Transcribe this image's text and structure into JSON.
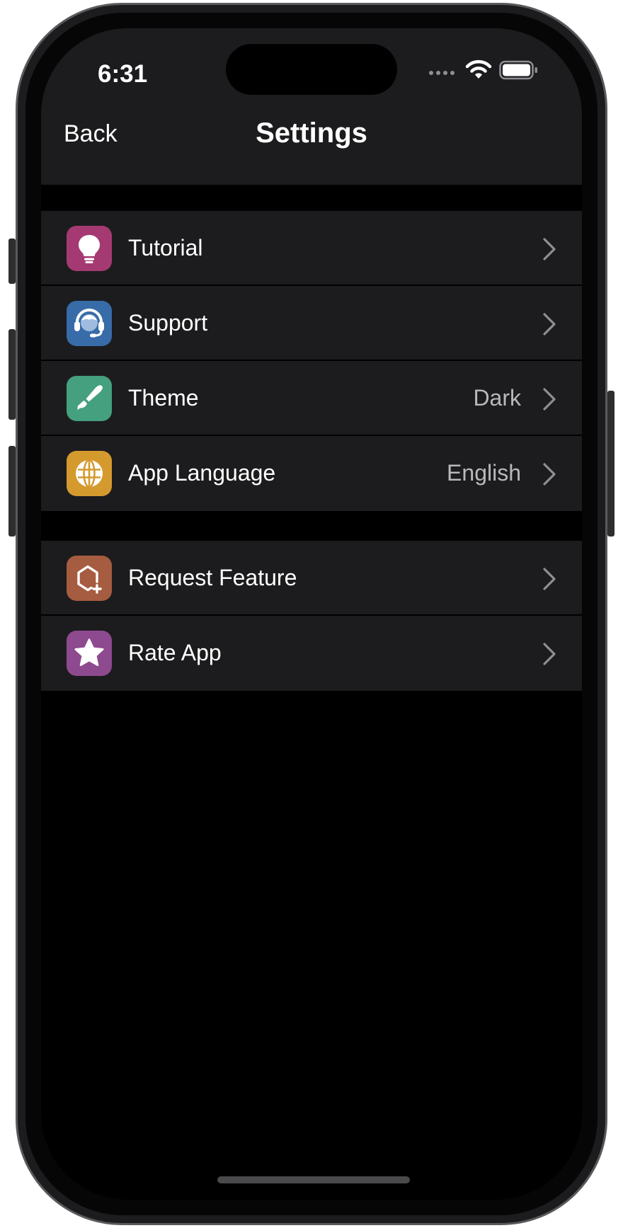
{
  "status_bar": {
    "time": "6:31"
  },
  "nav": {
    "back_label": "Back",
    "title": "Settings"
  },
  "groups": [
    {
      "items": [
        {
          "label": "Tutorial",
          "value": "",
          "icon": "lightbulb-icon",
          "icon_color": "#A53A72"
        },
        {
          "label": "Support",
          "value": "",
          "icon": "headset-icon",
          "icon_color": "#376CA8"
        },
        {
          "label": "Theme",
          "value": "Dark",
          "icon": "paintbrush-icon",
          "icon_color": "#45A07F"
        },
        {
          "label": "App Language",
          "value": "English",
          "icon": "globe-icon",
          "icon_color": "#D49A2E"
        }
      ]
    },
    {
      "items": [
        {
          "label": "Request Feature",
          "value": "",
          "icon": "hexagon-plus-icon",
          "icon_color": "#A65C40"
        },
        {
          "label": "Rate App",
          "value": "",
          "icon": "star-icon",
          "icon_color": "#8E4A8E"
        }
      ]
    }
  ],
  "colors": {
    "background": "#000000",
    "surface": "#1C1C1E",
    "text_primary": "#FFFFFF",
    "text_secondary": "#B8B8BD"
  }
}
